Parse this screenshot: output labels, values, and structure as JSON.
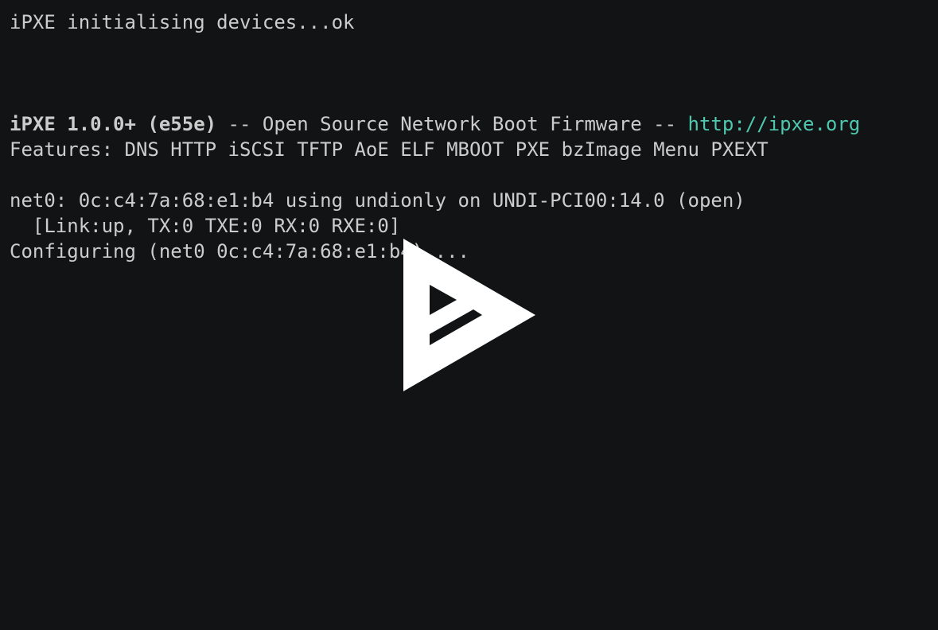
{
  "terminal": {
    "line1": "iPXE initialising devices...ok",
    "banner": {
      "product": "iPXE 1.0.0+ (e55e)",
      "separator_before": " -- ",
      "description": "Open Source Network Boot Firmware",
      "separator_after": " -- ",
      "url": "http://ipxe.org"
    },
    "features": "Features: DNS HTTP iSCSI TFTP AoE ELF MBOOT PXE bzImage Menu PXEXT",
    "net0": "net0: 0c:c4:7a:68:e1:b4 using undionly on UNDI-PCI00:14.0 (open)",
    "link_status": "  [Link:up, TX:0 TXE:0 RX:0 RXE:0]",
    "configuring": "Configuring (net0 0c:c4:7a:68:e1:b4)...."
  },
  "overlay": {
    "icon": "asciinema-play-icon",
    "color": "#ffffff"
  },
  "colors": {
    "background": "#121314",
    "text": "#cccccc",
    "link": "#4ec9b0"
  }
}
